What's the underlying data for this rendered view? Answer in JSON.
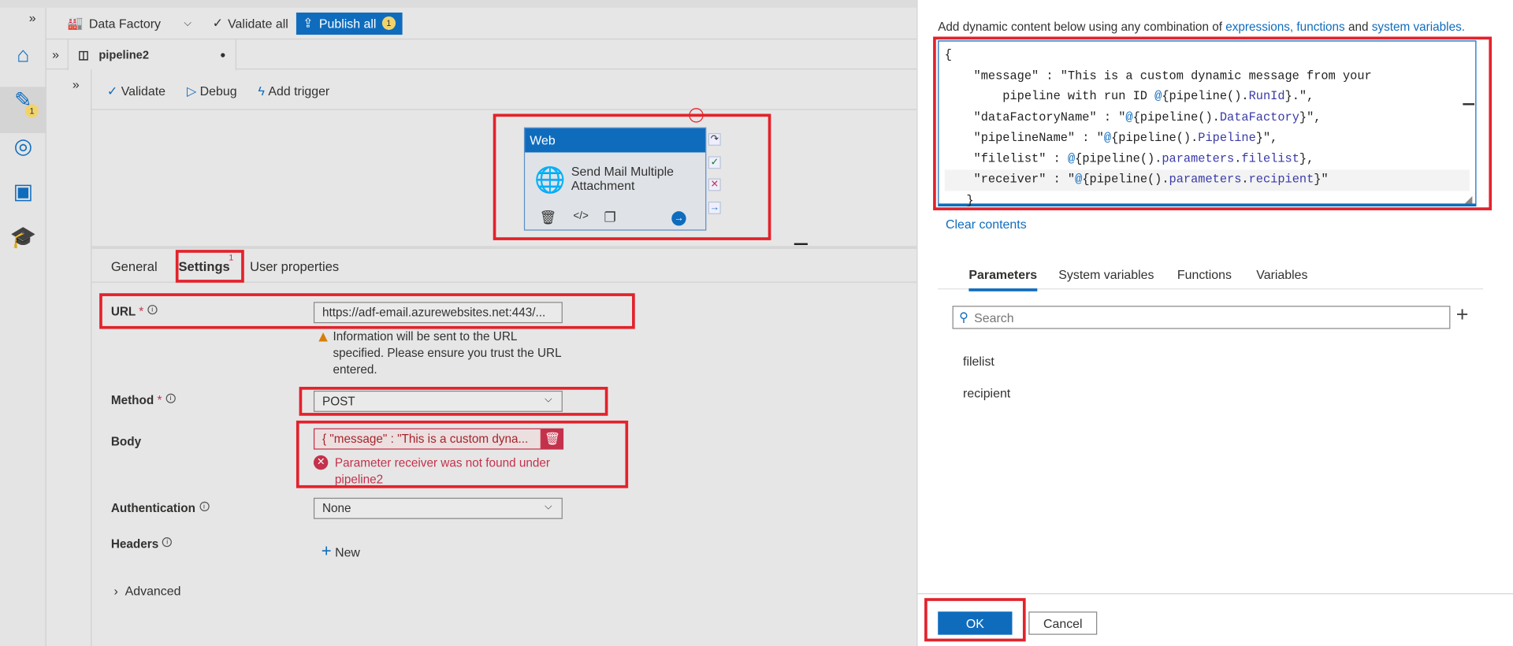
{
  "toolbar": {
    "factory": "Data Factory",
    "validate_all": "Validate all",
    "publish_all": "Publish all",
    "publish_count": "1"
  },
  "rail": {
    "author_badge": "1"
  },
  "tab": {
    "name": "pipeline2"
  },
  "pipeline_toolbar": {
    "validate": "Validate",
    "debug": "Debug",
    "add_trigger": "Add trigger"
  },
  "activity": {
    "type": "Web",
    "name": "Send Mail Multiple Attachment"
  },
  "props": {
    "tabs": [
      "General",
      "Settings",
      "User properties"
    ],
    "settings_badge": "1",
    "url_label": "URL",
    "url_value": "https://adf-email.azurewebsites.net:443/...",
    "url_warning": "Information will be sent to the URL specified. Please ensure you trust the URL entered.",
    "method_label": "Method",
    "method_value": "POST",
    "body_label": "Body",
    "body_value": "{ \"message\" : \"This is a custom dyna...",
    "body_error": "Parameter receiver was not found under pipeline2",
    "auth_label": "Authentication",
    "auth_value": "None",
    "headers_label": "Headers",
    "new_label": "New",
    "advanced_label": "Advanced",
    "required_mark": "*"
  },
  "panel": {
    "intro": "Add dynamic content below using any combination of ",
    "link1": "expressions, functions",
    "and": " and ",
    "link2": "system variables.",
    "code": [
      [
        {
          "t": "{",
          "c": "#222"
        }
      ],
      [
        {
          "t": "    \"message\" : \"This is a custom dynamic message from your",
          "c": "#222"
        }
      ],
      [
        {
          "t": "        pipeline with run ID ",
          "c": "#222"
        },
        {
          "t": "@",
          "c": "#0f6cbd"
        },
        {
          "t": "{pipeline().",
          "c": "#222"
        },
        {
          "t": "RunId",
          "c": "#3a3aa8"
        },
        {
          "t": "}.\",",
          "c": "#222"
        }
      ],
      [
        {
          "t": "    \"dataFactoryName\" : \"",
          "c": "#222"
        },
        {
          "t": "@",
          "c": "#0f6cbd"
        },
        {
          "t": "{pipeline().",
          "c": "#222"
        },
        {
          "t": "DataFactory",
          "c": "#3a3aa8"
        },
        {
          "t": "}\",",
          "c": "#222"
        }
      ],
      [
        {
          "t": "    \"pipelineName\" : \"",
          "c": "#222"
        },
        {
          "t": "@",
          "c": "#0f6cbd"
        },
        {
          "t": "{pipeline().",
          "c": "#222"
        },
        {
          "t": "Pipeline",
          "c": "#3a3aa8"
        },
        {
          "t": "}\",",
          "c": "#222"
        }
      ],
      [
        {
          "t": "    \"filelist\" : ",
          "c": "#222"
        },
        {
          "t": "@",
          "c": "#0f6cbd"
        },
        {
          "t": "{pipeline().",
          "c": "#222"
        },
        {
          "t": "parameters",
          "c": "#3a3aa8"
        },
        {
          "t": ".",
          "c": "#222"
        },
        {
          "t": "filelist",
          "c": "#3a3aa8"
        },
        {
          "t": "},",
          "c": "#222"
        }
      ],
      [
        {
          "t": "    \"receiver\" : \"",
          "c": "#222"
        },
        {
          "t": "@",
          "c": "#0f6cbd"
        },
        {
          "t": "{pipeline().",
          "c": "#222"
        },
        {
          "t": "parameters",
          "c": "#3a3aa8"
        },
        {
          "t": ".",
          "c": "#222"
        },
        {
          "t": "recipient",
          "c": "#3a3aa8"
        },
        {
          "t": "}\"",
          "c": "#222"
        }
      ],
      [
        {
          "t": "   }",
          "c": "#222"
        }
      ]
    ],
    "clear": "Clear contents",
    "tabs": [
      "Parameters",
      "System variables",
      "Functions",
      "Variables"
    ],
    "search_placeholder": "Search",
    "params": [
      "filelist",
      "recipient"
    ],
    "ok": "OK",
    "cancel": "Cancel"
  },
  "colors": {
    "accent": "#0f6cbd",
    "highlight": "#e3222b",
    "error": "#c4314b",
    "warning": "#d67f0a"
  }
}
